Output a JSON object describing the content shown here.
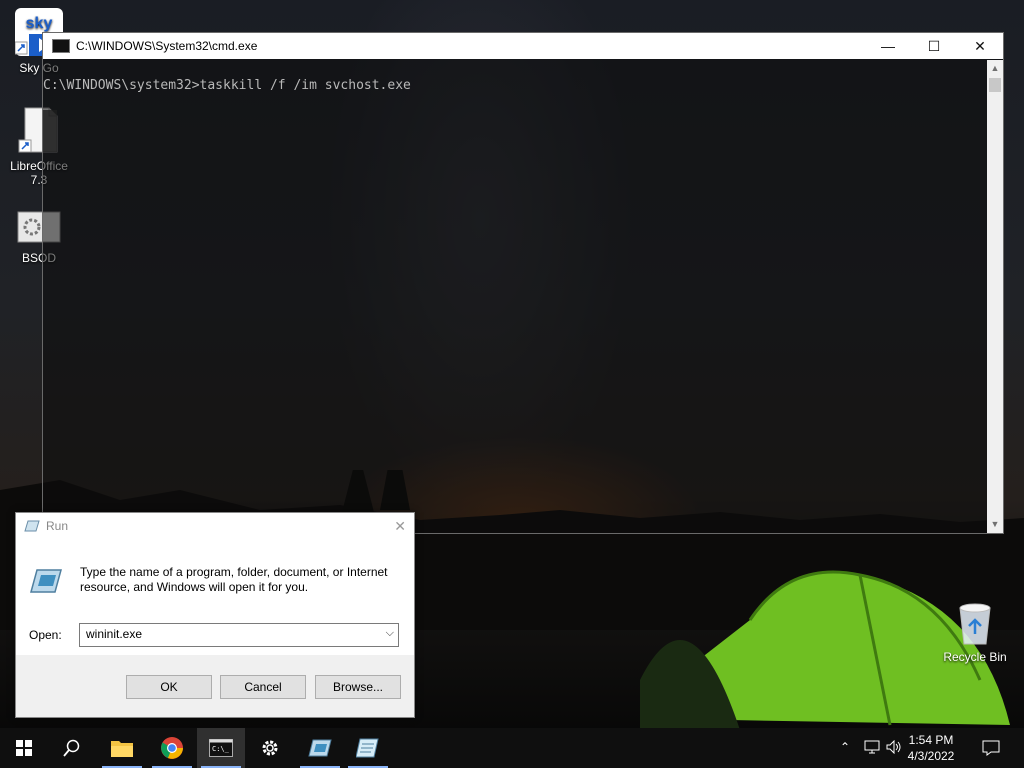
{
  "desktop": {
    "icons": [
      {
        "label": "Sky Go"
      },
      {
        "label": "LibreOffice 7.3"
      },
      {
        "label": "BSOD"
      }
    ],
    "recycle_bin": {
      "label": "Recycle Bin"
    }
  },
  "cmd_window": {
    "title": "C:\\WINDOWS\\System32\\cmd.exe",
    "prompt_line": "C:\\WINDOWS\\system32>taskkill /f /im svchost.exe",
    "controls": {
      "minimize": "—",
      "maximize": "☐",
      "close": "✕"
    }
  },
  "run_dialog": {
    "title": "Run",
    "message": "Type the name of a program, folder, document, or Internet resource, and Windows will open it for you.",
    "open_label": "Open:",
    "open_value": "wininit.exe",
    "buttons": {
      "ok": "OK",
      "cancel": "Cancel",
      "browse": "Browse..."
    }
  },
  "taskbar": {
    "items": [
      {
        "icon": "windows-start-icon"
      },
      {
        "icon": "search-icon"
      },
      {
        "icon": "file-explorer-icon",
        "running": true
      },
      {
        "icon": "chrome-icon",
        "running": true
      },
      {
        "icon": "command-prompt-icon",
        "running": true,
        "active": true
      },
      {
        "icon": "settings-gear-icon"
      },
      {
        "icon": "run-dialog-icon",
        "running": true
      },
      {
        "icon": "notepad-pad-icon",
        "running": true
      }
    ],
    "clock": {
      "time": "1:54 PM",
      "date": "4/3/2022"
    },
    "tray": [
      "chevron-up-icon",
      "network-icon",
      "volume-icon",
      "notification-icon"
    ]
  }
}
